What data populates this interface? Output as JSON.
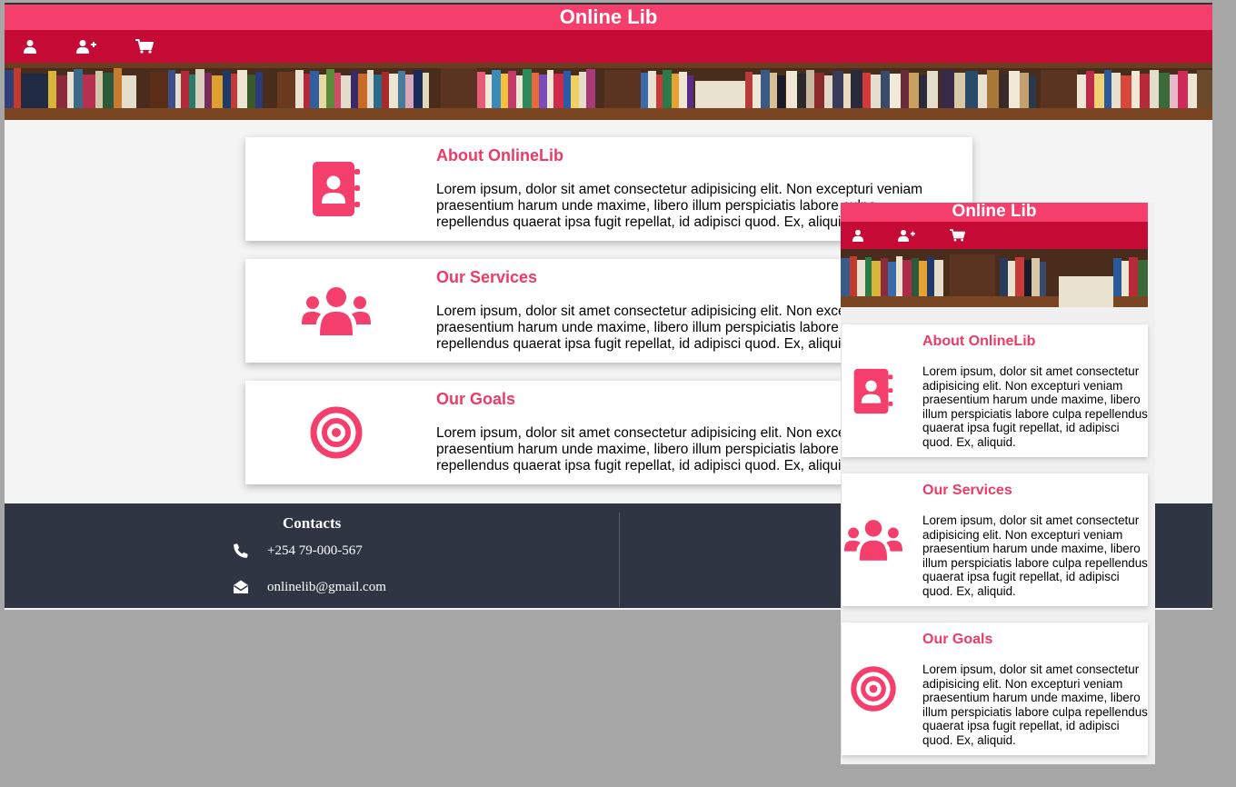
{
  "site": {
    "title": "Online Lib"
  },
  "nav": [
    {
      "icon": "user-icon"
    },
    {
      "icon": "user-plus-icon"
    },
    {
      "icon": "shopping-cart-icon"
    }
  ],
  "cards": [
    {
      "title": "About OnlineLib",
      "icon": "address-book-icon",
      "line1": "Lorem ipsum, dolor sit amet consectetur adipisicing elit. Non excepturi veniam",
      "line2": "praesentium harum unde maxime, libero illum perspiciatis labore culpa",
      "line3": "repellendus quaerat ipsa fugit repellat, id adipisci quod. Ex, aliquid."
    },
    {
      "title": "Our Services",
      "icon": "users-icon",
      "line1": "Lorem ipsum, dolor sit amet consectetur adipisicing elit. Non excepturi veniam",
      "line2": "praesentium harum unde maxime, libero illum perspiciatis labore culpa",
      "line3": "repellendus quaerat ipsa fugit repellat, id adipisci quod. Ex, aliquid."
    },
    {
      "title": "Our Goals",
      "icon": "bullseye-icon",
      "line1": "Lorem ipsum, dolor sit amet consectetur adipisicing elit. Non excepturi veniam",
      "line2": "praesentium harum unde maxime, libero illum perspiciatis labore culpa",
      "line3": "repellendus quaerat ipsa fugit repellat, id adipisci quod. Ex, aliquid."
    }
  ],
  "mobile_text": "Lorem ipsum, dolor sit amet consectetur adipisicing elit. Non excepturi veniam praesentium harum unde maxime, libero illum perspiciatis labore culpa repellendus quaerat ipsa fugit repellat, id adipisci quod. Ex, aliquid.",
  "footer": {
    "heading": "Contacts",
    "phone": "+254 79-000-567",
    "email": "onlinelib@gmail.com",
    "phone_icon": "phone-icon",
    "email_icon": "envelope-open-icon"
  },
  "colors": {
    "brand_pink": "#f43f6d",
    "nav_red": "#c40a35",
    "footer_bg": "#2f3542",
    "heading_pink": "#ec3b66"
  }
}
